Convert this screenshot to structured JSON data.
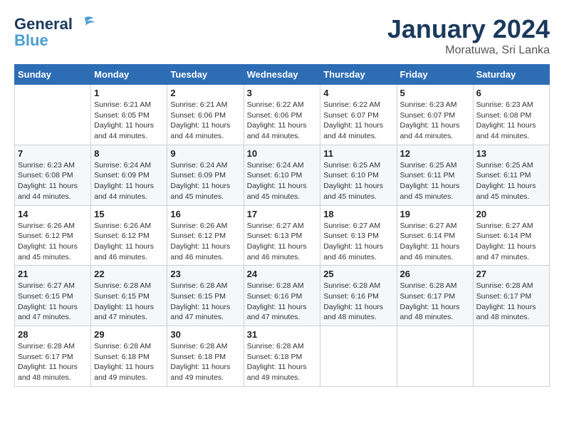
{
  "logo": {
    "line1": "General",
    "line2": "Blue"
  },
  "title": "January 2024",
  "location": "Moratuwa, Sri Lanka",
  "days_of_week": [
    "Sunday",
    "Monday",
    "Tuesday",
    "Wednesday",
    "Thursday",
    "Friday",
    "Saturday"
  ],
  "weeks": [
    [
      {
        "day": "",
        "info": ""
      },
      {
        "day": "1",
        "info": "Sunrise: 6:21 AM\nSunset: 6:05 PM\nDaylight: 11 hours\nand 44 minutes."
      },
      {
        "day": "2",
        "info": "Sunrise: 6:21 AM\nSunset: 6:06 PM\nDaylight: 11 hours\nand 44 minutes."
      },
      {
        "day": "3",
        "info": "Sunrise: 6:22 AM\nSunset: 6:06 PM\nDaylight: 11 hours\nand 44 minutes."
      },
      {
        "day": "4",
        "info": "Sunrise: 6:22 AM\nSunset: 6:07 PM\nDaylight: 11 hours\nand 44 minutes."
      },
      {
        "day": "5",
        "info": "Sunrise: 6:23 AM\nSunset: 6:07 PM\nDaylight: 11 hours\nand 44 minutes."
      },
      {
        "day": "6",
        "info": "Sunrise: 6:23 AM\nSunset: 6:08 PM\nDaylight: 11 hours\nand 44 minutes."
      }
    ],
    [
      {
        "day": "7",
        "info": "Sunrise: 6:23 AM\nSunset: 6:08 PM\nDaylight: 11 hours\nand 44 minutes."
      },
      {
        "day": "8",
        "info": "Sunrise: 6:24 AM\nSunset: 6:09 PM\nDaylight: 11 hours\nand 44 minutes."
      },
      {
        "day": "9",
        "info": "Sunrise: 6:24 AM\nSunset: 6:09 PM\nDaylight: 11 hours\nand 45 minutes."
      },
      {
        "day": "10",
        "info": "Sunrise: 6:24 AM\nSunset: 6:10 PM\nDaylight: 11 hours\nand 45 minutes."
      },
      {
        "day": "11",
        "info": "Sunrise: 6:25 AM\nSunset: 6:10 PM\nDaylight: 11 hours\nand 45 minutes."
      },
      {
        "day": "12",
        "info": "Sunrise: 6:25 AM\nSunset: 6:11 PM\nDaylight: 11 hours\nand 45 minutes."
      },
      {
        "day": "13",
        "info": "Sunrise: 6:25 AM\nSunset: 6:11 PM\nDaylight: 11 hours\nand 45 minutes."
      }
    ],
    [
      {
        "day": "14",
        "info": "Sunrise: 6:26 AM\nSunset: 6:12 PM\nDaylight: 11 hours\nand 45 minutes."
      },
      {
        "day": "15",
        "info": "Sunrise: 6:26 AM\nSunset: 6:12 PM\nDaylight: 11 hours\nand 46 minutes."
      },
      {
        "day": "16",
        "info": "Sunrise: 6:26 AM\nSunset: 6:12 PM\nDaylight: 11 hours\nand 46 minutes."
      },
      {
        "day": "17",
        "info": "Sunrise: 6:27 AM\nSunset: 6:13 PM\nDaylight: 11 hours\nand 46 minutes."
      },
      {
        "day": "18",
        "info": "Sunrise: 6:27 AM\nSunset: 6:13 PM\nDaylight: 11 hours\nand 46 minutes."
      },
      {
        "day": "19",
        "info": "Sunrise: 6:27 AM\nSunset: 6:14 PM\nDaylight: 11 hours\nand 46 minutes."
      },
      {
        "day": "20",
        "info": "Sunrise: 6:27 AM\nSunset: 6:14 PM\nDaylight: 11 hours\nand 47 minutes."
      }
    ],
    [
      {
        "day": "21",
        "info": "Sunrise: 6:27 AM\nSunset: 6:15 PM\nDaylight: 11 hours\nand 47 minutes."
      },
      {
        "day": "22",
        "info": "Sunrise: 6:28 AM\nSunset: 6:15 PM\nDaylight: 11 hours\nand 47 minutes."
      },
      {
        "day": "23",
        "info": "Sunrise: 6:28 AM\nSunset: 6:15 PM\nDaylight: 11 hours\nand 47 minutes."
      },
      {
        "day": "24",
        "info": "Sunrise: 6:28 AM\nSunset: 6:16 PM\nDaylight: 11 hours\nand 47 minutes."
      },
      {
        "day": "25",
        "info": "Sunrise: 6:28 AM\nSunset: 6:16 PM\nDaylight: 11 hours\nand 48 minutes."
      },
      {
        "day": "26",
        "info": "Sunrise: 6:28 AM\nSunset: 6:17 PM\nDaylight: 11 hours\nand 48 minutes."
      },
      {
        "day": "27",
        "info": "Sunrise: 6:28 AM\nSunset: 6:17 PM\nDaylight: 11 hours\nand 48 minutes."
      }
    ],
    [
      {
        "day": "28",
        "info": "Sunrise: 6:28 AM\nSunset: 6:17 PM\nDaylight: 11 hours\nand 48 minutes."
      },
      {
        "day": "29",
        "info": "Sunrise: 6:28 AM\nSunset: 6:18 PM\nDaylight: 11 hours\nand 49 minutes."
      },
      {
        "day": "30",
        "info": "Sunrise: 6:28 AM\nSunset: 6:18 PM\nDaylight: 11 hours\nand 49 minutes."
      },
      {
        "day": "31",
        "info": "Sunrise: 6:28 AM\nSunset: 6:18 PM\nDaylight: 11 hours\nand 49 minutes."
      },
      {
        "day": "",
        "info": ""
      },
      {
        "day": "",
        "info": ""
      },
      {
        "day": "",
        "info": ""
      }
    ]
  ]
}
